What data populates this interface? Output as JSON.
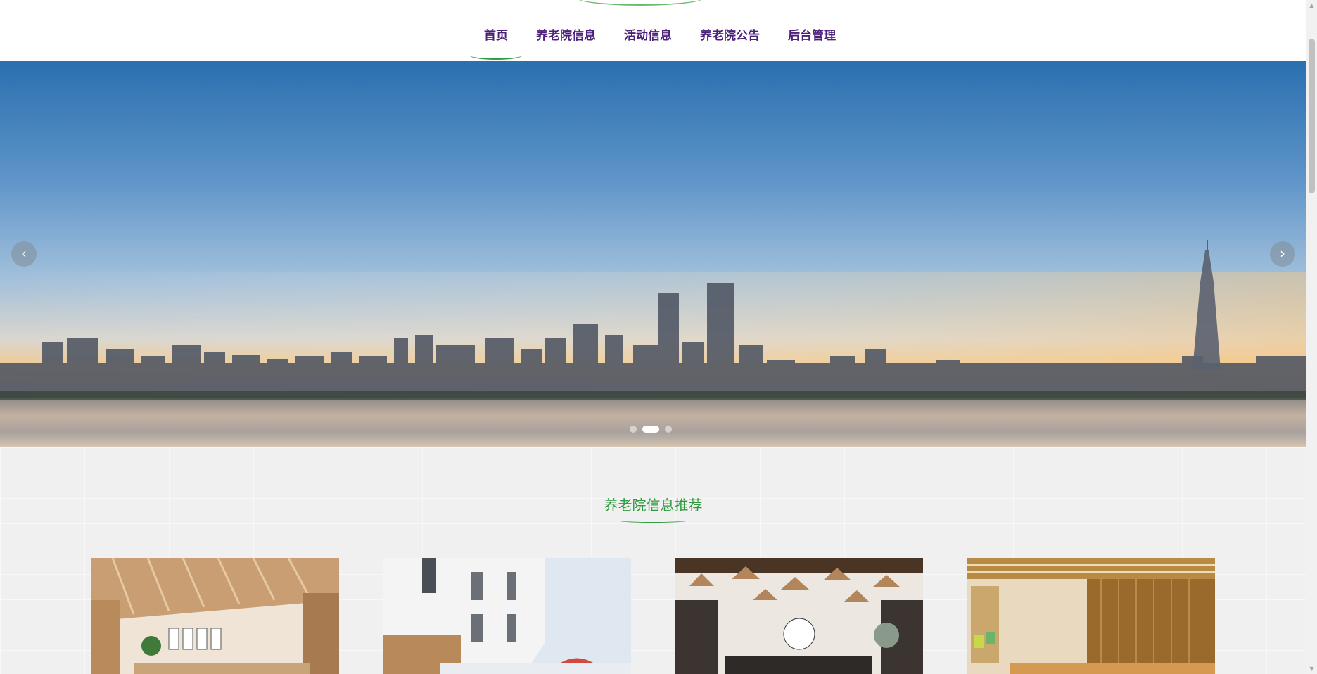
{
  "nav": {
    "items": [
      {
        "label": "首页",
        "active": true
      },
      {
        "label": "养老院信息",
        "active": false
      },
      {
        "label": "活动信息",
        "active": false
      },
      {
        "label": "养老院公告",
        "active": false
      },
      {
        "label": "后台管理",
        "active": false
      }
    ]
  },
  "banner": {
    "prev_icon": "chevron-left-icon",
    "next_icon": "chevron-right-icon",
    "prev_glyph": "‹",
    "next_glyph": "›",
    "slide_count": 3,
    "active_slide": 2
  },
  "section": {
    "title": "养老院信息推荐"
  },
  "colors": {
    "nav_text": "#4b1f7a",
    "accent_green": "#2f9a3f",
    "section_bg": "#f0f0f0"
  }
}
